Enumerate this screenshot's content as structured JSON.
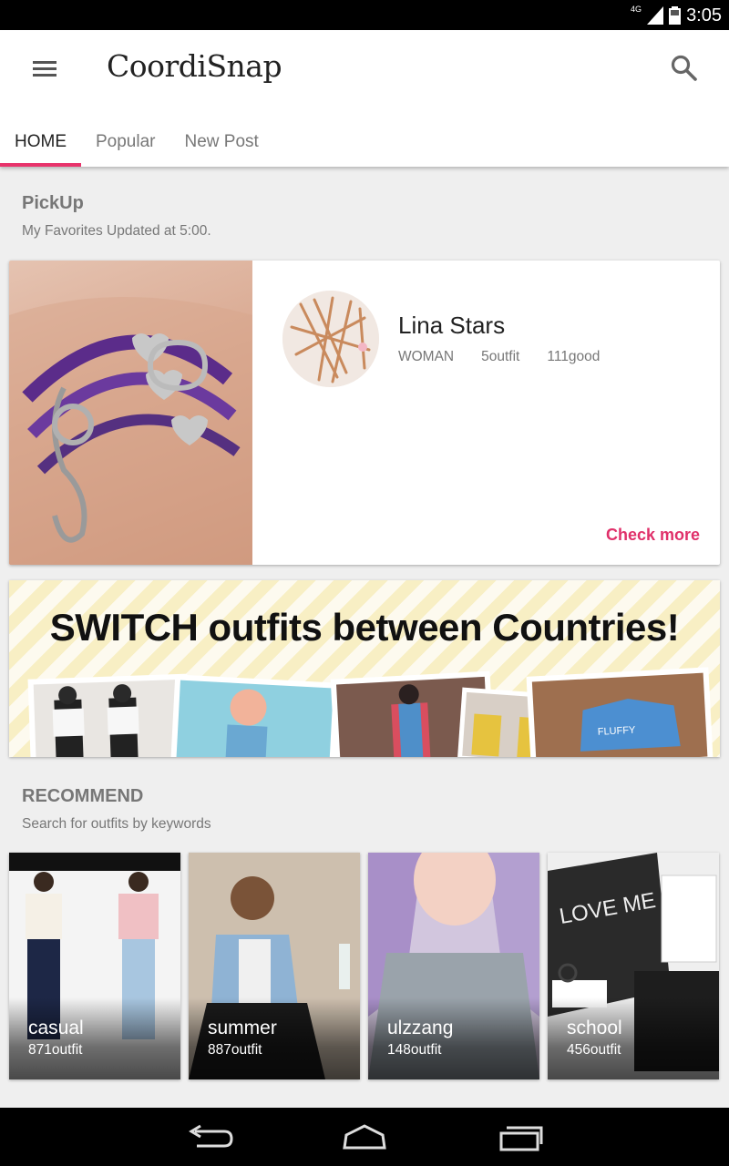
{
  "status_bar": {
    "network": "4G",
    "time": "3:05"
  },
  "app": {
    "title": "CoordiSnap"
  },
  "tabs": [
    {
      "label": "HOME",
      "active": true
    },
    {
      "label": "Popular",
      "active": false
    },
    {
      "label": "New Post",
      "active": false
    }
  ],
  "pickup": {
    "title": "PickUp",
    "subtitle": "My Favorites Updated at 5:00.",
    "user_name": "Lina Stars",
    "category": "WOMAN",
    "outfits": "5outfit",
    "goods": "111good",
    "check_more": "Check more"
  },
  "banner": {
    "text": "SWITCH outfits between Countries!"
  },
  "recommend": {
    "title": "RECOMMEND",
    "subtitle": "Search for outfits by keywords",
    "items": [
      {
        "label": "casual",
        "count": "871outfit"
      },
      {
        "label": "summer",
        "count": "887outfit"
      },
      {
        "label": "ulzzang",
        "count": "148outfit"
      },
      {
        "label": "school",
        "count": "456outfit"
      }
    ]
  },
  "colors": {
    "accent": "#e8336b",
    "check_more": "#e0306a"
  }
}
